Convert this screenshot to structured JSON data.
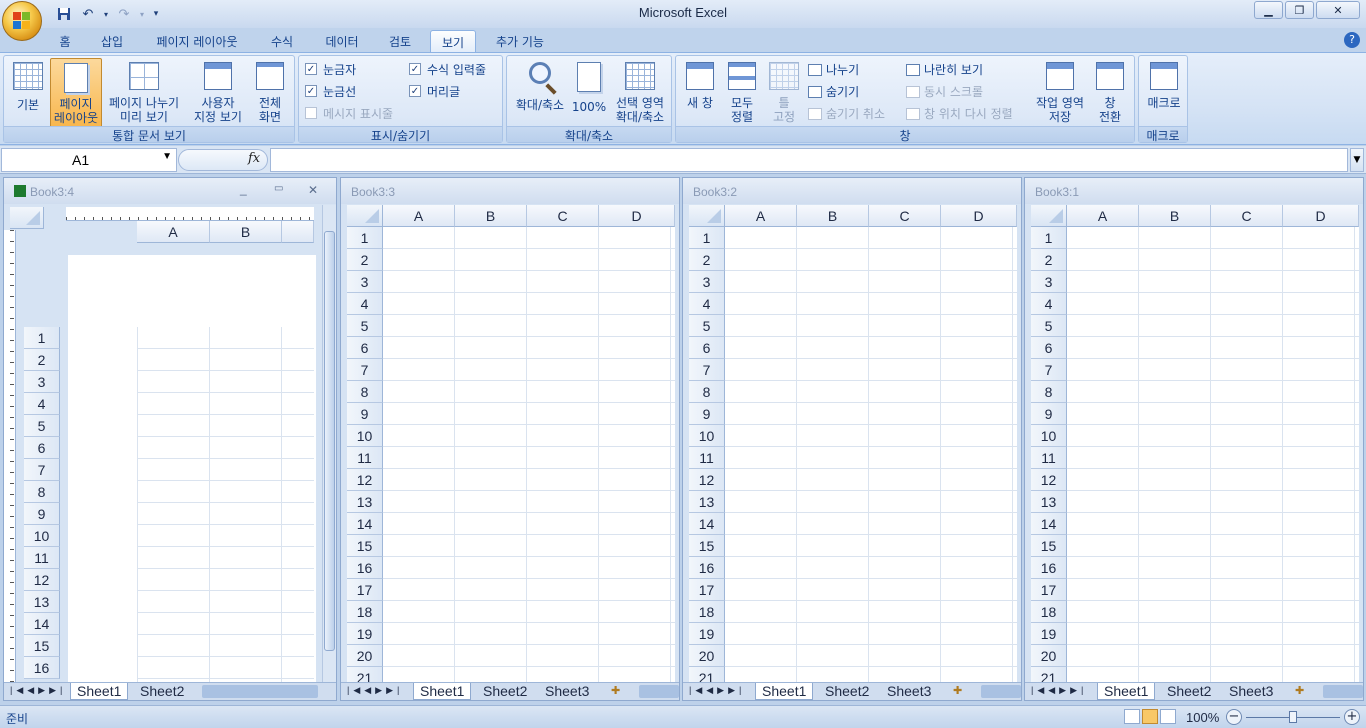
{
  "app": {
    "title": "Microsoft Excel"
  },
  "tabs": [
    {
      "label": "홈"
    },
    {
      "label": "삽입"
    },
    {
      "label": "페이지 레이아웃"
    },
    {
      "label": "수식"
    },
    {
      "label": "데이터"
    },
    {
      "label": "검토"
    },
    {
      "label": "보기",
      "active": true
    },
    {
      "label": "추가 기능"
    }
  ],
  "ribbon": {
    "workbook_views": {
      "label": "통합 문서 보기",
      "normal": "기본",
      "page_layout_1": "페이지",
      "page_layout_2": "레이아웃",
      "page_break_1": "페이지 나누기",
      "page_break_2": "미리 보기",
      "custom_1": "사용자",
      "custom_2": "지정 보기",
      "fullscreen_1": "전체",
      "fullscreen_2": "화면"
    },
    "show_hide": {
      "label": "표시/숨기기",
      "ruler": "눈금자",
      "gridlines": "눈금선",
      "message_bar": "메시지 표시줄",
      "formula_bar": "수식 입력줄",
      "headings": "머리글"
    },
    "zoom": {
      "label": "확대/축소",
      "zoom": "확대/축소",
      "hundred": "100%",
      "selection_1": "선택 영역",
      "selection_2": "확대/축소"
    },
    "window": {
      "label": "창",
      "new_window": "새 창",
      "arrange_1": "모두",
      "arrange_2": "정렬",
      "freeze_1": "틀",
      "freeze_2": "고정",
      "split": "나누기",
      "hide": "숨기기",
      "unhide": "숨기기 취소",
      "side_by_side": "나란히 보기",
      "sync_scroll": "동시 스크롤",
      "reset_position": "창 위치 다시 정렬",
      "save_workspace_1": "작업 영역",
      "save_workspace_2": "저장",
      "switch_1": "창",
      "switch_2": "전환"
    },
    "macros": {
      "label": "매크로",
      "macros": "매크로"
    }
  },
  "formula_bar": {
    "name_box": "A1",
    "fx": "fx",
    "formula": ""
  },
  "windows": [
    {
      "title": "Book3:4",
      "sheets": [
        "Sheet1",
        "Sheet2"
      ]
    },
    {
      "title": "Book3:3",
      "sheets": [
        "Sheet1",
        "Sheet2",
        "Sheet3"
      ]
    },
    {
      "title": "Book3:2",
      "sheets": [
        "Sheet1",
        "Sheet2",
        "Sheet3"
      ]
    },
    {
      "title": "Book3:1",
      "sheets": [
        "Sheet1",
        "Sheet2",
        "Sheet3"
      ]
    }
  ],
  "columns": [
    "A",
    "B",
    "C",
    "D"
  ],
  "status": {
    "ready": "준비",
    "zoom": "100%"
  }
}
